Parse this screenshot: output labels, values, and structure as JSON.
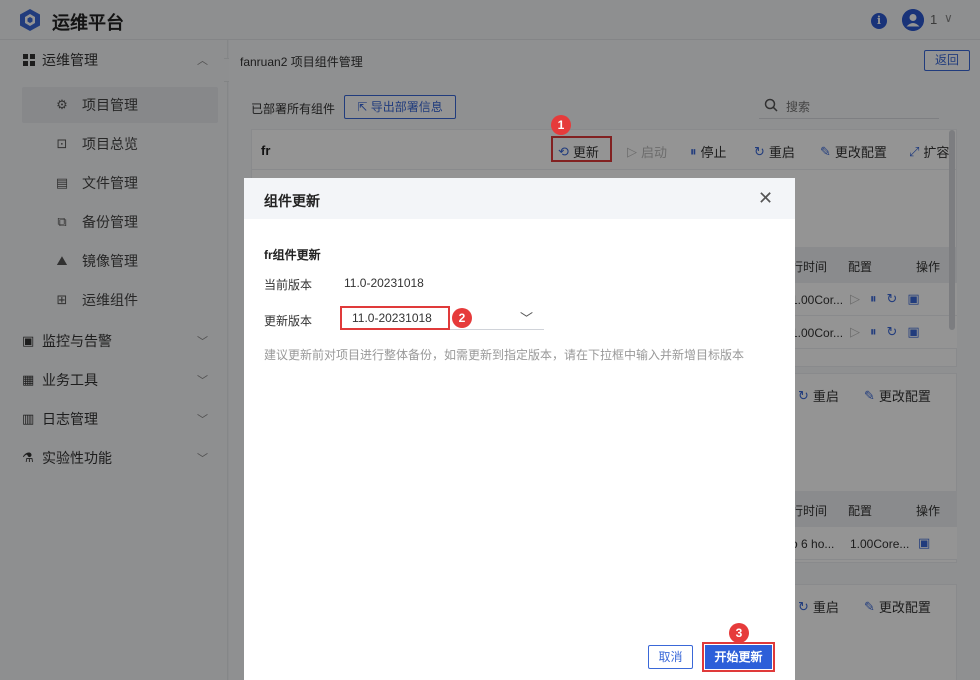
{
  "app": {
    "title": "运维平台"
  },
  "header": {
    "user": "1"
  },
  "sidebar": {
    "groups": [
      {
        "label": "运维管理",
        "expanded": true
      },
      {
        "label": "监控与告警"
      },
      {
        "label": "业务工具"
      },
      {
        "label": "日志管理"
      },
      {
        "label": "实验性功能"
      }
    ],
    "sub_items": [
      "项目管理",
      "项目总览",
      "文件管理",
      "备份管理",
      "镜像管理",
      "运维组件"
    ],
    "active": "项目管理"
  },
  "main": {
    "breadcrumb": "fanruan2 项目组件管理",
    "back_label": "返回",
    "deployed_label": "已部署所有组件",
    "export_label": "导出部署信息",
    "search_placeholder": "搜索",
    "card1": {
      "title": "fr",
      "actions": {
        "update": "更新",
        "start": "启动",
        "stop": "停止",
        "restart": "重启",
        "edit_config": "更改配置",
        "scale": "扩容"
      },
      "table_headers": {
        "runtime": "行时间",
        "config": "配置",
        "ops": "操作"
      },
      "rows": [
        {
          "config": "1.00Cor..."
        },
        {
          "config": "1.00Cor..."
        }
      ]
    },
    "card2": {
      "actions": {
        "restart": "重启",
        "edit_config": "更改配置"
      },
      "table_headers": {
        "runtime": "行时间",
        "config": "配置",
        "ops": "操作"
      },
      "rows": [
        {
          "runtime": "o 6 ho...",
          "config": "1.00Core..."
        }
      ]
    },
    "card3": {
      "actions": {
        "restart": "重启",
        "edit_config": "更改配置"
      }
    }
  },
  "dialog": {
    "title": "组件更新",
    "section_title": "fr组件更新",
    "current_version_label": "当前版本",
    "current_version": "11.0-20231018",
    "update_version_label": "更新版本",
    "update_version": "11.0-20231018",
    "hint": "建议更新前对项目进行整体备份，如需更新到指定版本，请在下拉框中输入并新增目标版本",
    "cancel_label": "取消",
    "start_label": "开始更新"
  },
  "markers": [
    "1",
    "2",
    "3"
  ],
  "colors": {
    "accent": "#2d5fd9",
    "highlight": "#e03a3a"
  }
}
